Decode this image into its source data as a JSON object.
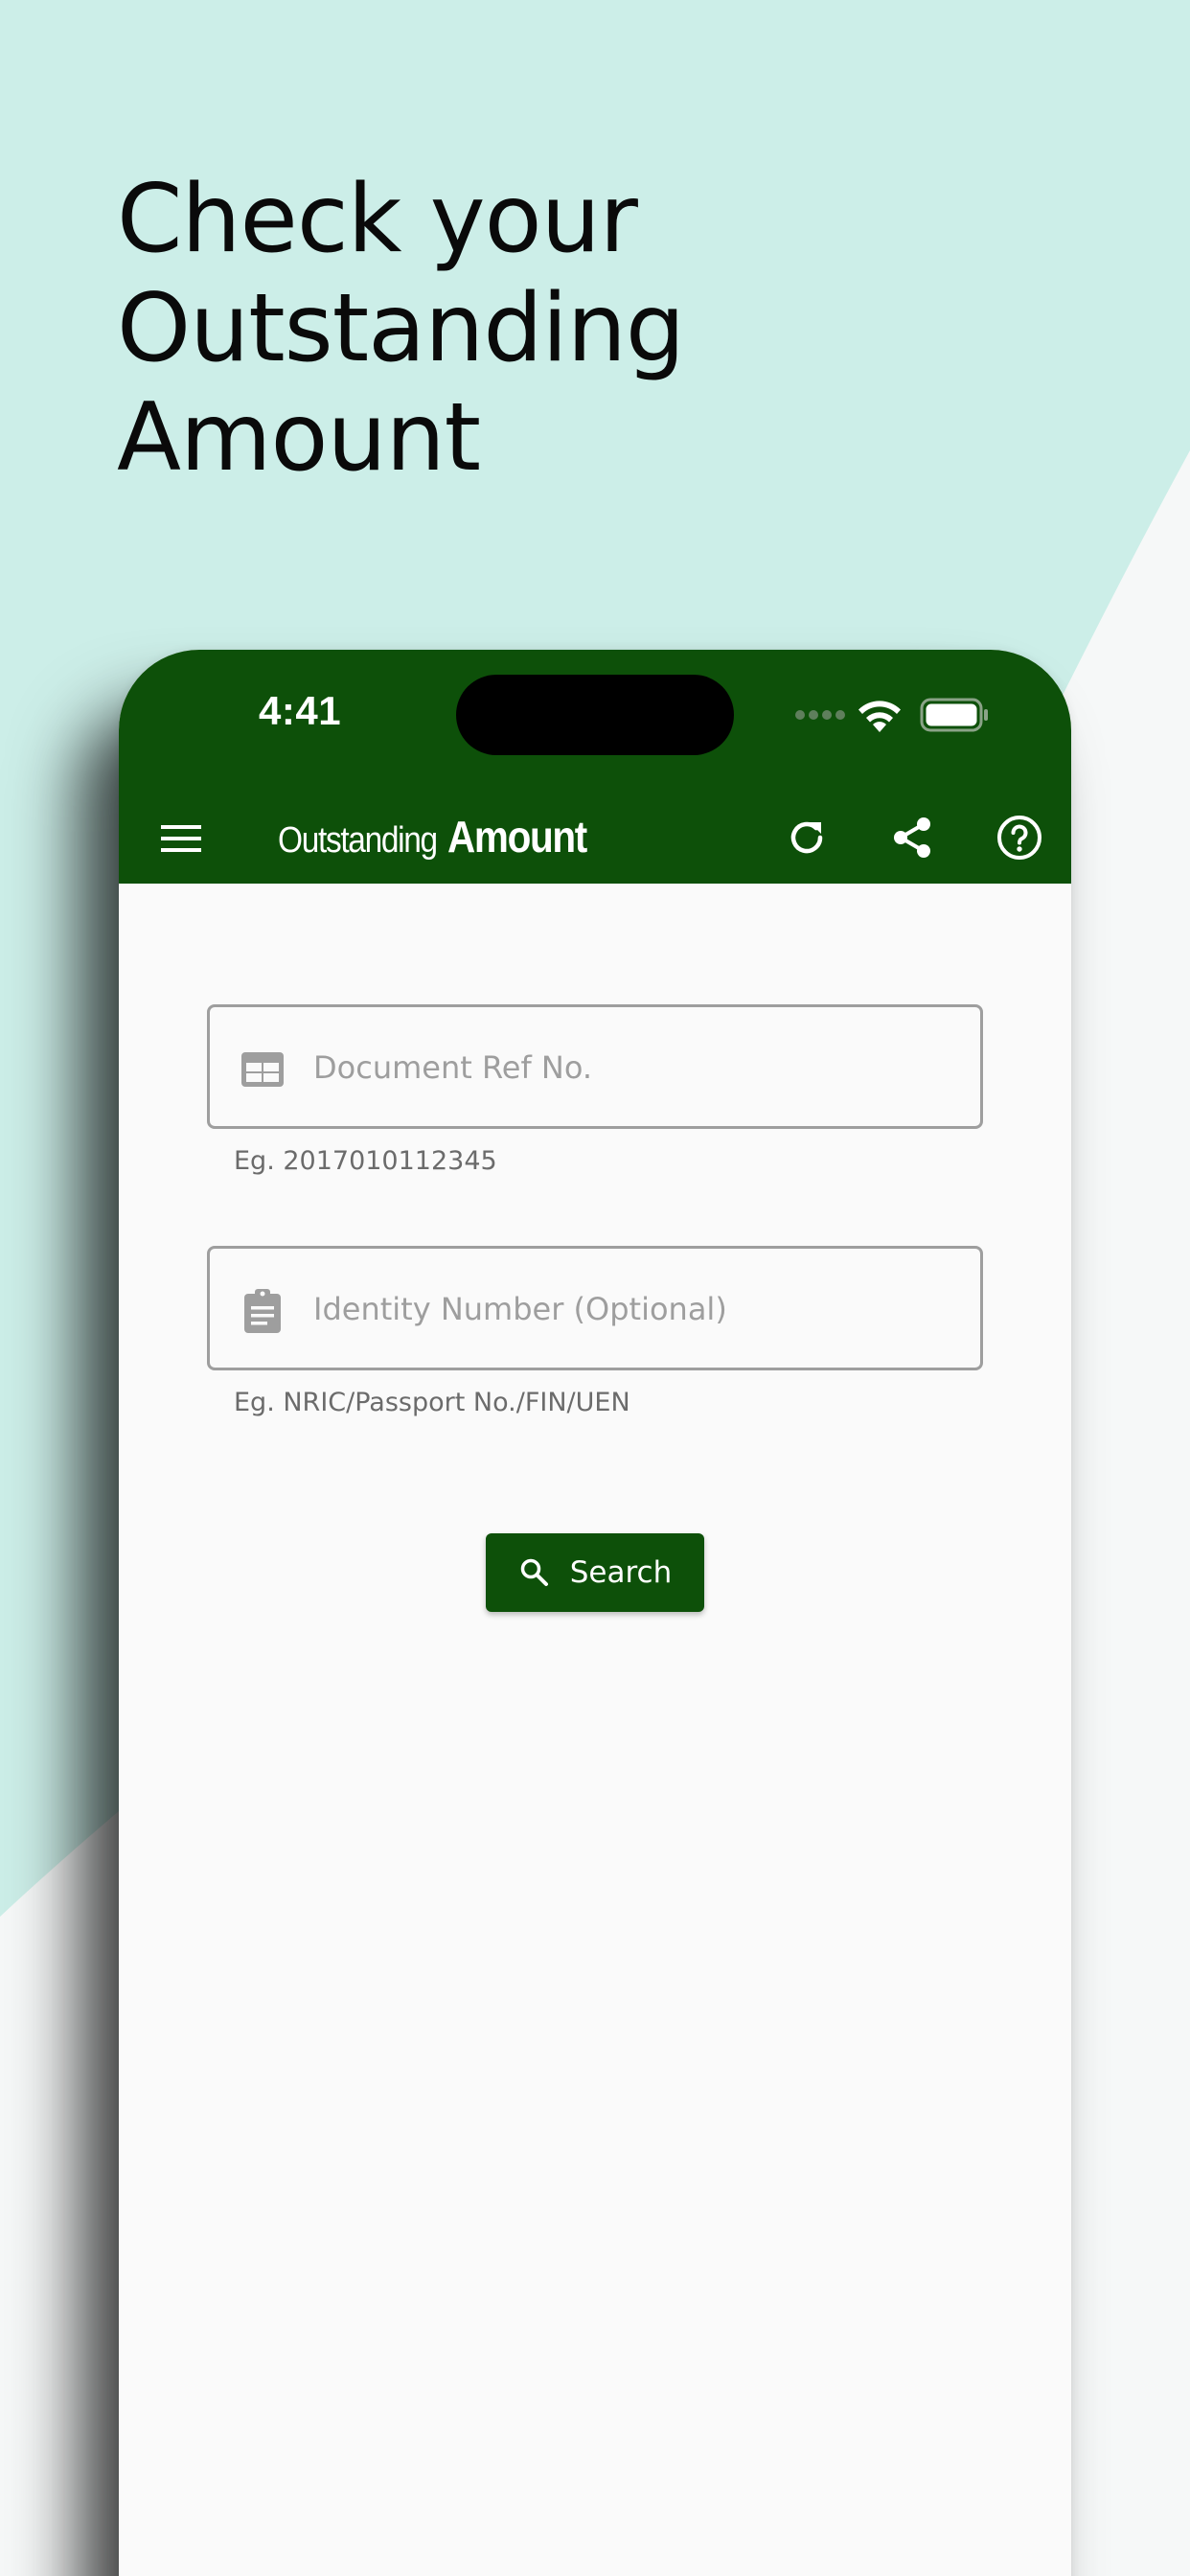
{
  "headline": [
    "Check your",
    "Outstanding",
    "Amount"
  ],
  "status_bar": {
    "time": "4:41",
    "icons": [
      "cellular-signal-icon",
      "wifi-icon",
      "battery-icon"
    ]
  },
  "app_bar": {
    "title_light": "Outstanding",
    "title_bold": "Amount",
    "actions": [
      "menu-icon",
      "refresh-icon",
      "share-icon",
      "help-icon"
    ]
  },
  "form": {
    "document_ref": {
      "placeholder": "Document Ref No.",
      "value": "",
      "helper": "Eg. 2017010112345",
      "icon": "document-card-icon"
    },
    "identity": {
      "placeholder": "Identity Number (Optional)",
      "value": "",
      "helper": "Eg. NRIC/Passport No./FIN/UEN",
      "icon": "clipboard-icon"
    },
    "search_button": {
      "label": "Search",
      "icon": "search-icon"
    }
  },
  "colors": {
    "primary": "#0d5009",
    "background_mint": "#cceee8",
    "field_border": "#9e9e9e",
    "placeholder": "#9e9e9e"
  }
}
